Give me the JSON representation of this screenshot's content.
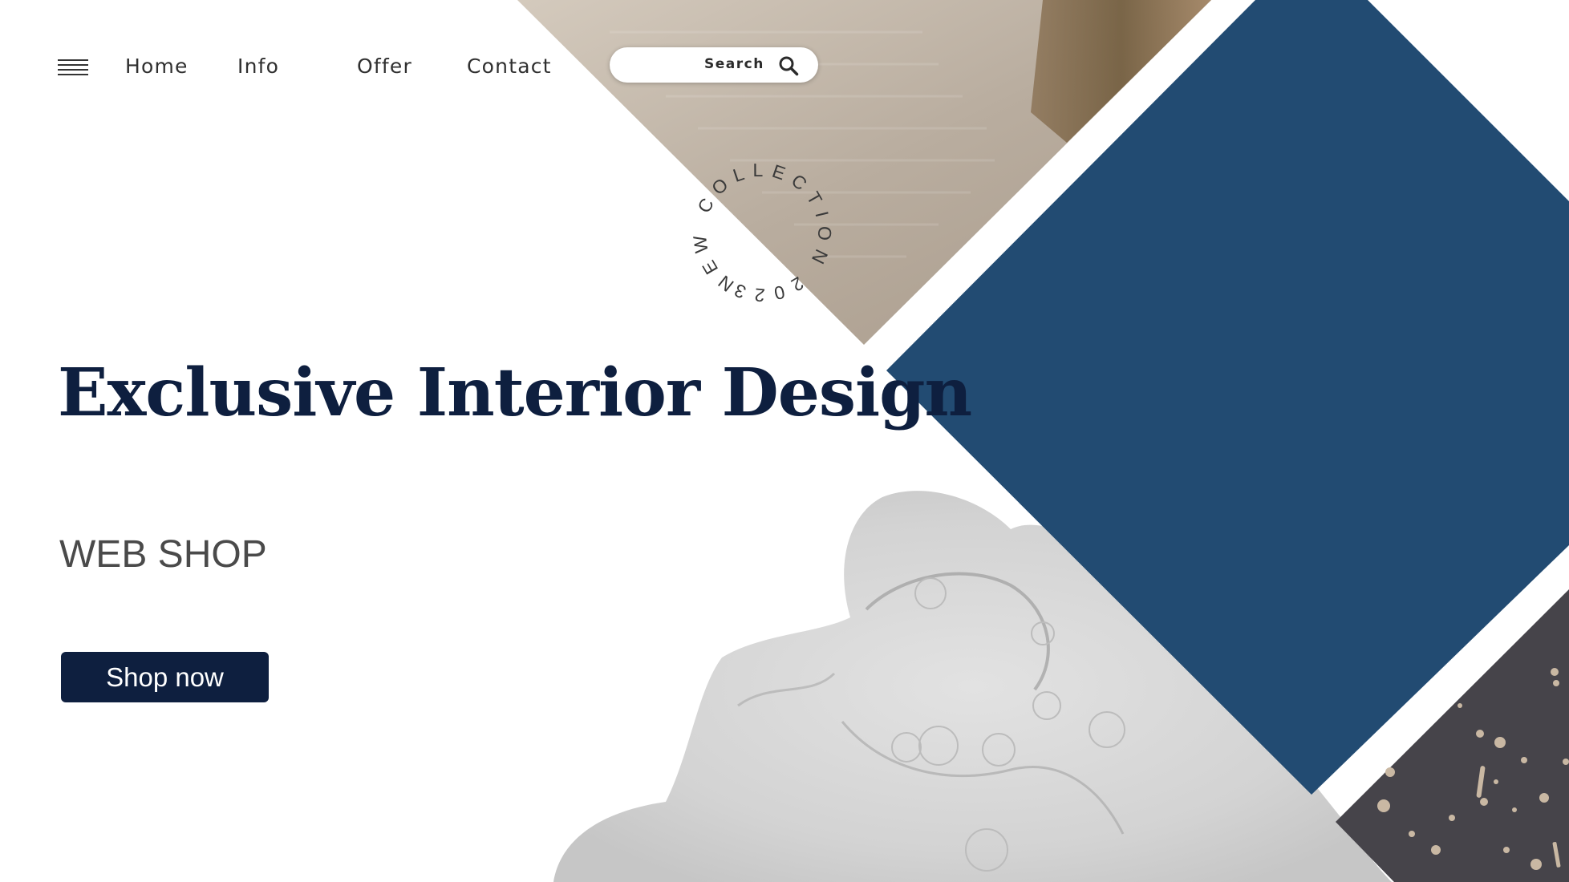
{
  "nav": {
    "menu_icon": "hamburger-menu-icon",
    "links": [
      "Home",
      "Info",
      "Offer",
      "Contact"
    ]
  },
  "search": {
    "label": "Search",
    "placeholder": "",
    "icon": "search-icon"
  },
  "badge": {
    "text": "NEW COLLECTION 2023."
  },
  "hero": {
    "title": "Exclusive Interior Design",
    "subtitle": "WEB SHOP",
    "cta_label": "Shop now"
  },
  "colors": {
    "primary_navy": "#0e1f3f",
    "diamond_blue": "#224b72",
    "charcoal": "#46444a",
    "marble_grey": "#d6d6d6",
    "photo_beige": "#bdb1a3",
    "text_dark": "#2f2f2f"
  }
}
